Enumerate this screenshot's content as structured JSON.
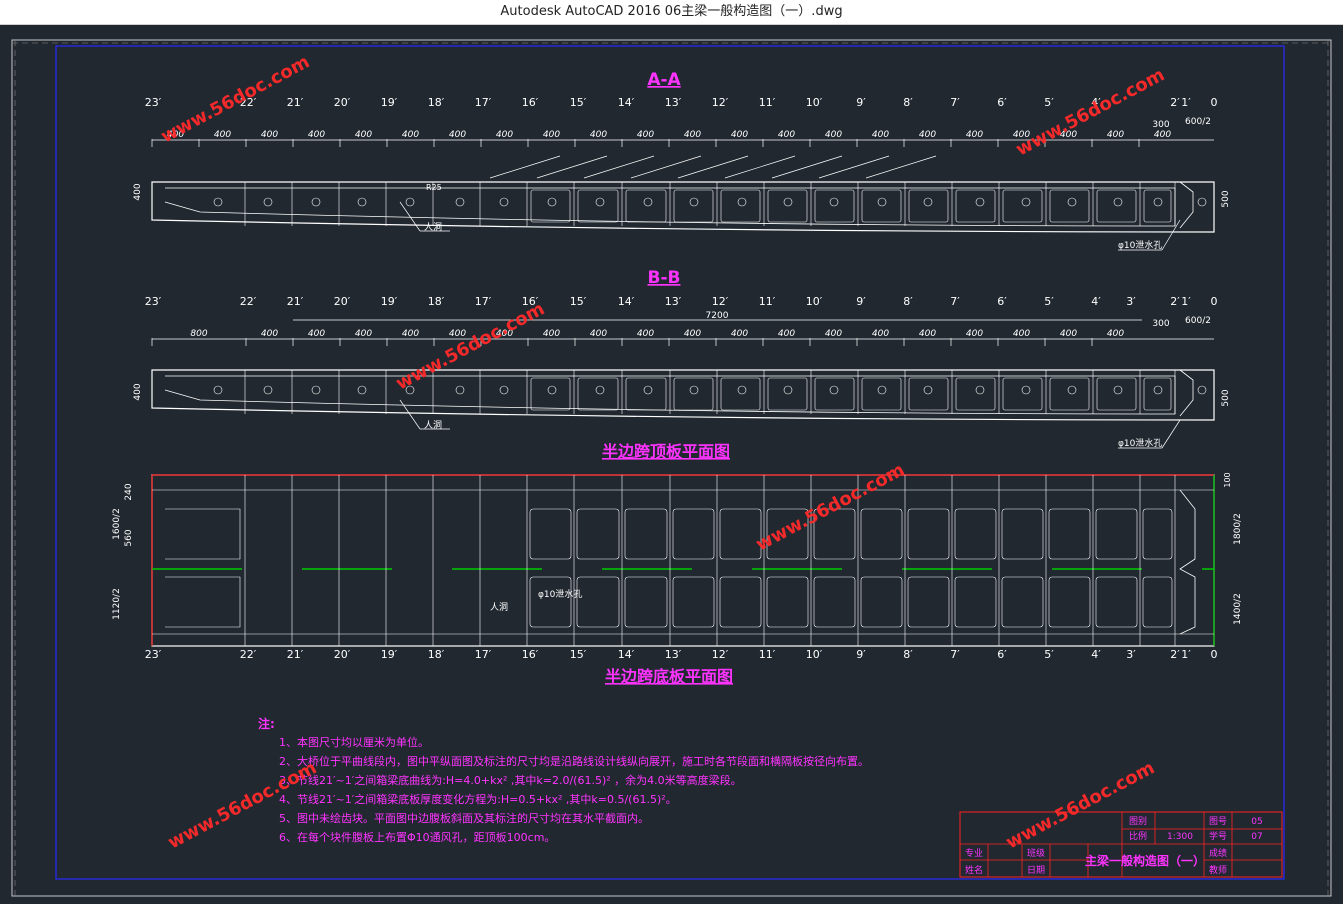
{
  "window": {
    "title": "Autodesk AutoCAD 2016     06主梁一般构造图（一）.dwg"
  },
  "colors": {
    "background": "#212830",
    "frame": "#c8c8c8",
    "inner_frame": "#2a2aff",
    "geometry": "#ffffff",
    "heading": "#ff33ff",
    "dimension": "#ffffff",
    "notes": "#ff33ff",
    "watermark": "#ff2a2a",
    "centerline": "#00cc00",
    "edge": "#ff2222"
  },
  "watermark": {
    "text": "www.56doc.com"
  },
  "sections": {
    "aa": {
      "title": "A-A"
    },
    "bb": {
      "title": "B-B"
    }
  },
  "segment_labels": [
    "23′",
    "22′",
    "21′",
    "20′",
    "19′",
    "18′",
    "17′",
    "16′",
    "15′",
    "14′",
    "13′",
    "12′",
    "11′",
    "10′",
    "9′",
    "8′",
    "7′",
    "6′",
    "5′",
    "4′",
    "3′",
    "2′",
    "1′",
    "0"
  ],
  "dims_aa": [
    "400",
    "400",
    "400",
    "400",
    "400",
    "400",
    "400",
    "400",
    "400",
    "400",
    "400",
    "400",
    "400",
    "400",
    "400",
    "400",
    "400",
    "400",
    "400",
    "400",
    "400",
    "400"
  ],
  "dims_bb": [
    "800",
    "400",
    "400",
    "400",
    "400",
    "400",
    "400",
    "400",
    "400",
    "400",
    "400",
    "400",
    "400",
    "400",
    "400",
    "400",
    "400",
    "400",
    "400",
    "400",
    "400"
  ],
  "dims_common": {
    "tail_300": "300",
    "tail_600": "600/2",
    "height_400": "400",
    "height_500": "500",
    "total_7200": "7200",
    "r25": "R25"
  },
  "labels": {
    "manhole": "人洞",
    "drain": "φ10泄水孔",
    "top_plan": "半边跨顶板平面图",
    "bottom_plan": "半边跨底板平面图"
  },
  "plan_dims": {
    "left": [
      "240",
      "1600/2",
      "560",
      "1120/2"
    ],
    "right": [
      "100",
      "1800/2",
      "1400/2"
    ]
  },
  "notes": {
    "heading": "注:",
    "items": [
      "1、本图尺寸均以厘米为单位。",
      "2、大桥位于平曲线段内，图中平纵面图及标注的尺寸均是沿路线设计线纵向展开，施工时各节段面和横隔板按径向布置。",
      "3、节线21′~1′之间箱梁底曲线为:H=4.0+kx²  ,其中k=2.0/(61.5)²  ，余为4.0米等高度梁段。",
      "4、节线21′~1′之间箱梁底板厚度变化方程为:H=0.5+kx²  ,其中k=0.5/(61.5)²。",
      "5、图中未绘齿块。平面图中边腹板斜面及其标注的尺寸均在其水平截面内。",
      "6、在每个块件腹板上布置Φ10通风孔，距顶板100cm。"
    ]
  },
  "title_block": {
    "drawing_title": "主梁一般构造图（一）",
    "row1": [
      "图别",
      "",
      "图号",
      "05"
    ],
    "row2": [
      "比例",
      "1:300",
      "学号",
      "07"
    ],
    "left_labels": [
      "专业",
      "姓名",
      "班级",
      "日期"
    ],
    "right_labels": [
      "成绩",
      "教师"
    ]
  }
}
